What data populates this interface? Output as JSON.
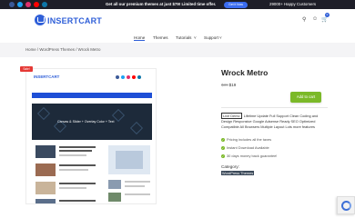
{
  "topbar": {
    "promo_text": "Get all our premium themes at just $79! Limited time offer.",
    "promo_button": "Get it Now",
    "happy_customers": "29000+ Happy Customers",
    "social_colors": [
      "#3b5998",
      "#1da1f2",
      "#e1306c",
      "#ff0000",
      "#0e76a8"
    ]
  },
  "header": {
    "logo_text": "INSERTCART",
    "nav": [
      "Home",
      "Themes",
      "Tutorials",
      "Support"
    ],
    "cart_count": "0"
  },
  "breadcrumb": "Home / WordPress Themes / Wrock Metro",
  "preview": {
    "sale_badge": "Sale!",
    "screenshot_logo": "INSERTCART",
    "hero_text": "Canvas & Slider + Overlay Color + Text"
  },
  "product": {
    "title": "Wrock Metro",
    "old_price": "$39",
    "new_price": "$19",
    "add_to_cart": "Add to cart",
    "live_demo": "Live Demo",
    "description": "Lifetime Update Full Support Clean Coding and Design Responsive Google Adsense Ready SEO Optimized Compatible All Browsers Multiple Layout Lots more features",
    "features": [
      "Pricing includes all the taxes",
      "Instant Download Available",
      "30 days money back guarantee!"
    ],
    "category_label": "Category:",
    "category_value": "WordPress Themes"
  },
  "colors": {
    "brand": "#2f5fd8",
    "add_to_cart": "#7bb928",
    "sale": "#e53935"
  }
}
